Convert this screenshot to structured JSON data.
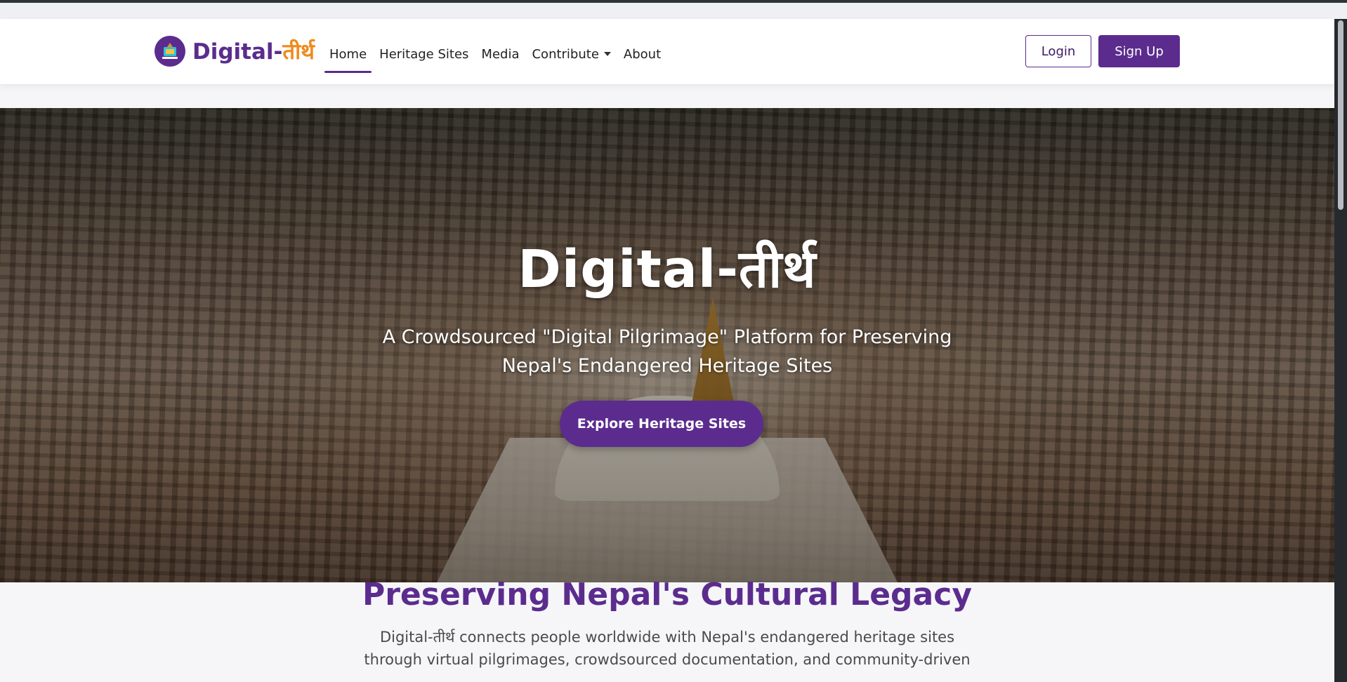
{
  "brand": {
    "name_prefix": "Digital-",
    "name_suffix": "तीर्थ"
  },
  "nav": {
    "links": [
      {
        "label": "Home",
        "active": true
      },
      {
        "label": "Heritage Sites",
        "active": false
      },
      {
        "label": "Media",
        "active": false
      },
      {
        "label": "Contribute",
        "active": false,
        "dropdown": true
      },
      {
        "label": "About",
        "active": false
      }
    ],
    "login_label": "Login",
    "signup_label": "Sign Up"
  },
  "hero": {
    "title": "Digital-तीर्थ",
    "subtitle_line1": "A Crowdsourced \"Digital Pilgrimage\" Platform for Preserving",
    "subtitle_line2": "Nepal's Endangered Heritage Sites",
    "cta_label": "Explore Heritage Sites"
  },
  "section": {
    "title": "Preserving Nepal's Cultural Legacy",
    "body_line1": "Digital-तीर्थ connects people worldwide with Nepal's endangered heritage sites",
    "body_line2": "through virtual pilgrimages, crowdsourced documentation, and community-driven"
  },
  "colors": {
    "brand_purple": "#5b2c8e",
    "brand_orange": "#f08a1c"
  },
  "icons": {
    "logo": "heritage-logo-icon",
    "dropdown": "caret-down-icon"
  }
}
